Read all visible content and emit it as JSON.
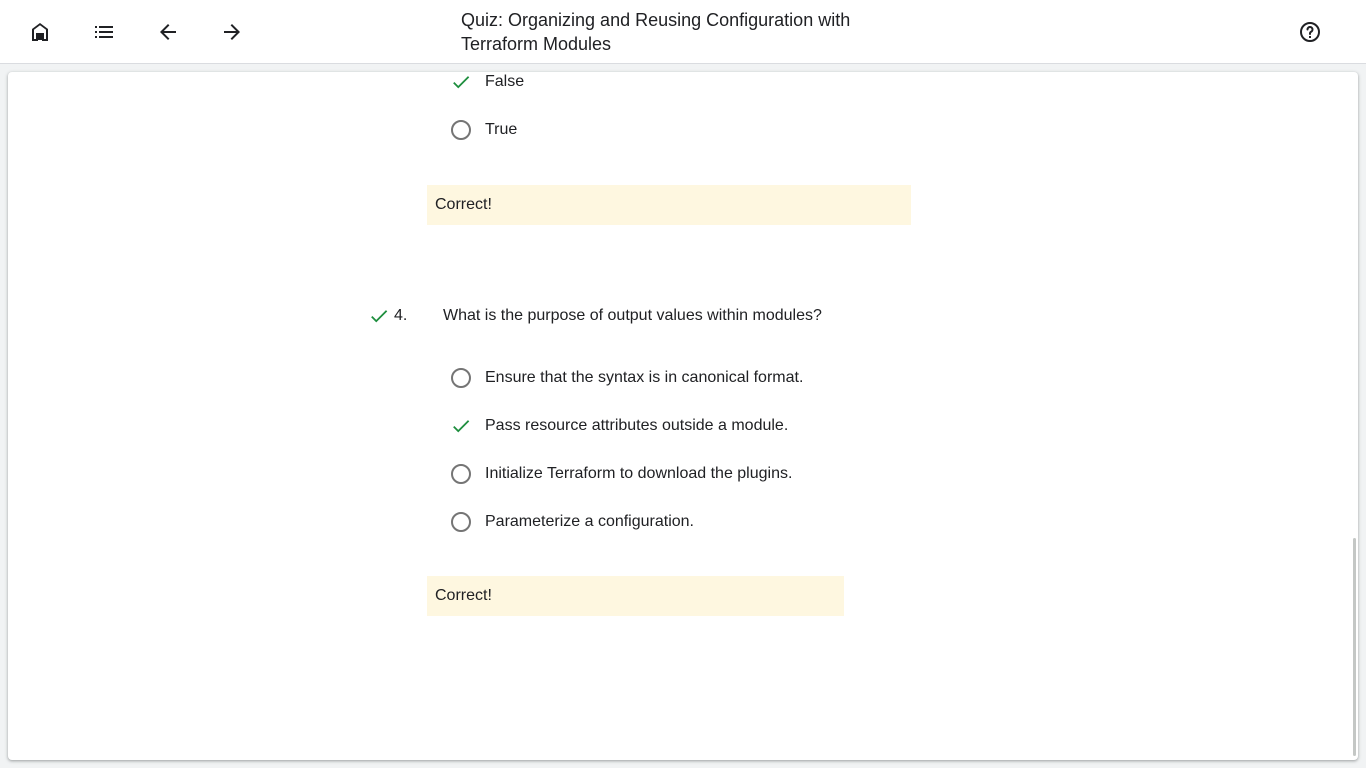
{
  "header": {
    "title": "Quiz: Organizing and Reusing Configuration with Terraform Modules",
    "icons": [
      "home-icon",
      "list-icon",
      "arrow-back-icon",
      "arrow-forward-icon",
      "help-icon"
    ]
  },
  "colors": {
    "check": "#1e8e3e",
    "feedback_bg": "#fef7e0",
    "radio_border": "#757575"
  },
  "previous_question": {
    "options": [
      {
        "label": "False",
        "selected": true
      },
      {
        "label": "True",
        "selected": false
      }
    ],
    "feedback": "Correct!"
  },
  "question": {
    "number": "4.",
    "text": "What is the purpose of output values within modules?",
    "options": [
      {
        "label": "Ensure that the syntax is in canonical format.",
        "selected": false
      },
      {
        "label": "Pass resource attributes outside a module.",
        "selected": true
      },
      {
        "label": "Initialize Terraform to download the plugins.",
        "selected": false
      },
      {
        "label": "Parameterize a configuration.",
        "selected": false
      }
    ],
    "feedback": "Correct!"
  }
}
